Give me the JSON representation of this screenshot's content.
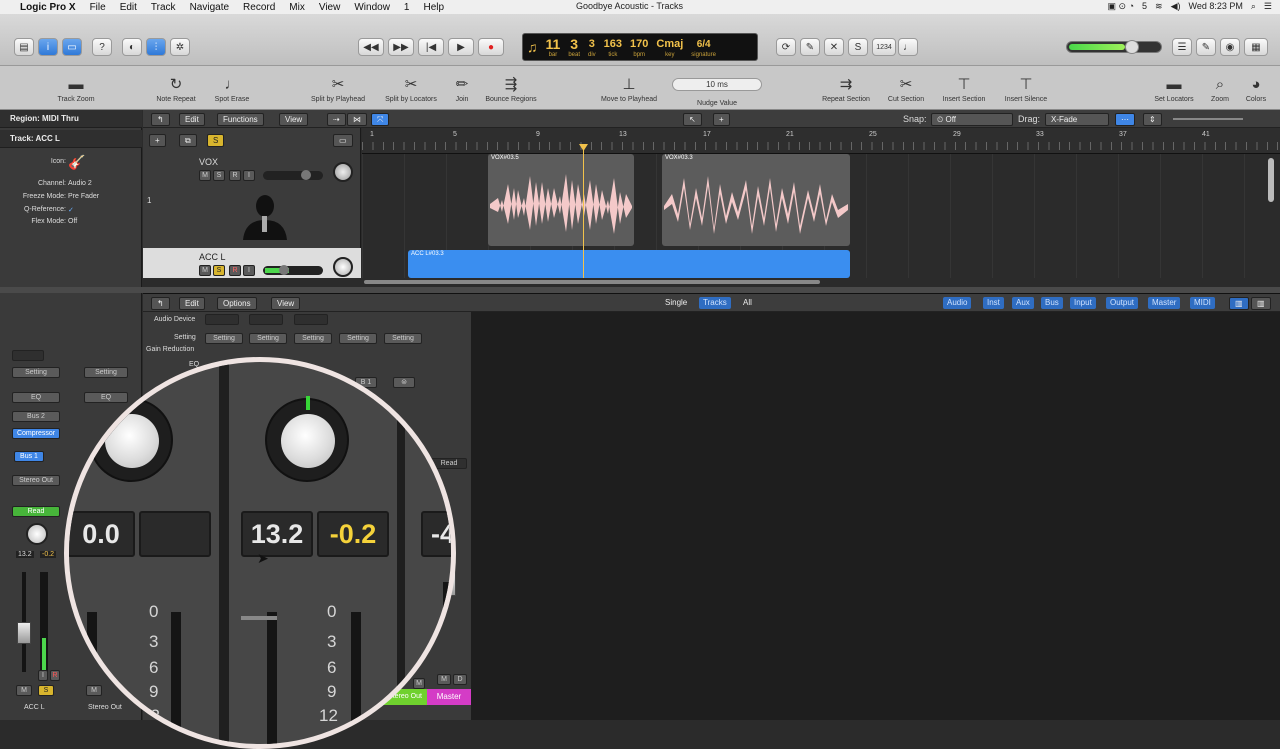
{
  "menubar": {
    "app": "Logic Pro X",
    "items": [
      "File",
      "Edit",
      "Track",
      "Navigate",
      "Record",
      "Mix",
      "View",
      "Window",
      "1",
      "Help"
    ],
    "window_title": "Goodbye Acoustic - Tracks",
    "battery": "5",
    "clock": "Wed 8:23 PM"
  },
  "lcd": {
    "bar": "11",
    "bar_label": "bar",
    "beat": "3",
    "beat_label": "beat",
    "div": "3",
    "div_label": "div",
    "tick": "163",
    "tick_label": "tick",
    "bpm": "170",
    "bpm_label": "bpm",
    "key": "Cmaj",
    "key_label": "key",
    "signature": "6/4",
    "signature_label": "signature"
  },
  "controlbar": {
    "count_in": "1234"
  },
  "toolbar": {
    "track_zoom": "Track Zoom",
    "note_repeat": "Note Repeat",
    "spot_erase": "Spot Erase",
    "split_playhead": "Split by Playhead",
    "split_locators": "Split by Locators",
    "join": "Join",
    "bounce_regions": "Bounce Regions",
    "move_to_playhead": "Move to Playhead",
    "nudge_value": "10 ms",
    "nudge_label": "Nudge Value",
    "repeat_section": "Repeat Section",
    "cut_section": "Cut Section",
    "insert_section": "Insert Section",
    "insert_silence": "Insert Silence",
    "set_locators": "Set Locators",
    "zoom": "Zoom",
    "colors": "Colors"
  },
  "inspector": {
    "region": "Region: MIDI Thru",
    "track": "Track:  ACC L",
    "icon_label": "Icon:",
    "channel_label": "Channel:",
    "channel_value": "Audio 2",
    "freeze_label": "Freeze Mode:",
    "freeze_value": "Pre Fader",
    "qref_label": "Q-Reference:",
    "flex_label": "Flex Mode:",
    "flex_value": "Off",
    "strip1": {
      "setting": "Setting",
      "eq": "EQ",
      "bus": "Bus 2",
      "plugin": "Compressor",
      "send": "Bus 1",
      "output": "Stereo Out",
      "automation": "Read",
      "vol": "13.2",
      "pan": "-0.2",
      "mute": "M",
      "solo": "S",
      "name": "ACC L",
      "input": "I",
      "record": "R"
    },
    "strip2": {
      "setting": "Setting",
      "eq": "EQ",
      "mute": "M",
      "name": "Stereo Out"
    }
  },
  "arrange_bar": {
    "edit": "Edit",
    "functions": "Functions",
    "view": "View",
    "snap_label": "Snap:",
    "snap_value": "Off",
    "drag_label": "Drag:",
    "drag_value": "X-Fade",
    "solo_btn": "S"
  },
  "ruler": [
    "1",
    "5",
    "9",
    "13",
    "17",
    "21",
    "25",
    "29",
    "33",
    "37",
    "41"
  ],
  "tracks": [
    {
      "number": "1",
      "name": "VOX",
      "mute": "M",
      "solo": "S",
      "record": "R",
      "input": "I"
    },
    {
      "name": "ACC L",
      "mute": "M",
      "solo": "S",
      "record": "R",
      "input": "I"
    }
  ],
  "regions": [
    {
      "name": "VOX#03.5"
    },
    {
      "name": "VOX#03.3"
    },
    {
      "name": "ACC L#03.3"
    }
  ],
  "mixer_bar": {
    "edit": "Edit",
    "options": "Options",
    "view": "View",
    "single": "Single",
    "tracks": "Tracks",
    "all": "All",
    "filters": [
      "Audio",
      "Inst",
      "Aux",
      "Bus",
      "Input",
      "Output",
      "Master",
      "MIDI"
    ]
  },
  "mixer": {
    "audio_device": "Audio Device",
    "setting_label": "Setting",
    "gain_reduction": "Gain Reduction",
    "eq_label": "EQ",
    "settings": [
      "Setting",
      "Setting",
      "Setting",
      "Setting",
      "Setting"
    ],
    "send_b1": "B 1",
    "read": "Read",
    "stereo_out": "Stereo Out",
    "master": "Master",
    "mute": "M",
    "solo": "S",
    "dim": "D"
  },
  "magnifier": {
    "values": [
      "0.0",
      "13.2",
      "-0.2",
      "-4"
    ],
    "scale": [
      "0",
      "3",
      "6",
      "9",
      "12"
    ]
  },
  "colors": {
    "region_audio": "#f4c9c9",
    "region_blue": "#3a8ef0",
    "lcd": "#f2c24b",
    "master": "#d43cc6",
    "stereo_out": "#6fd12e"
  }
}
